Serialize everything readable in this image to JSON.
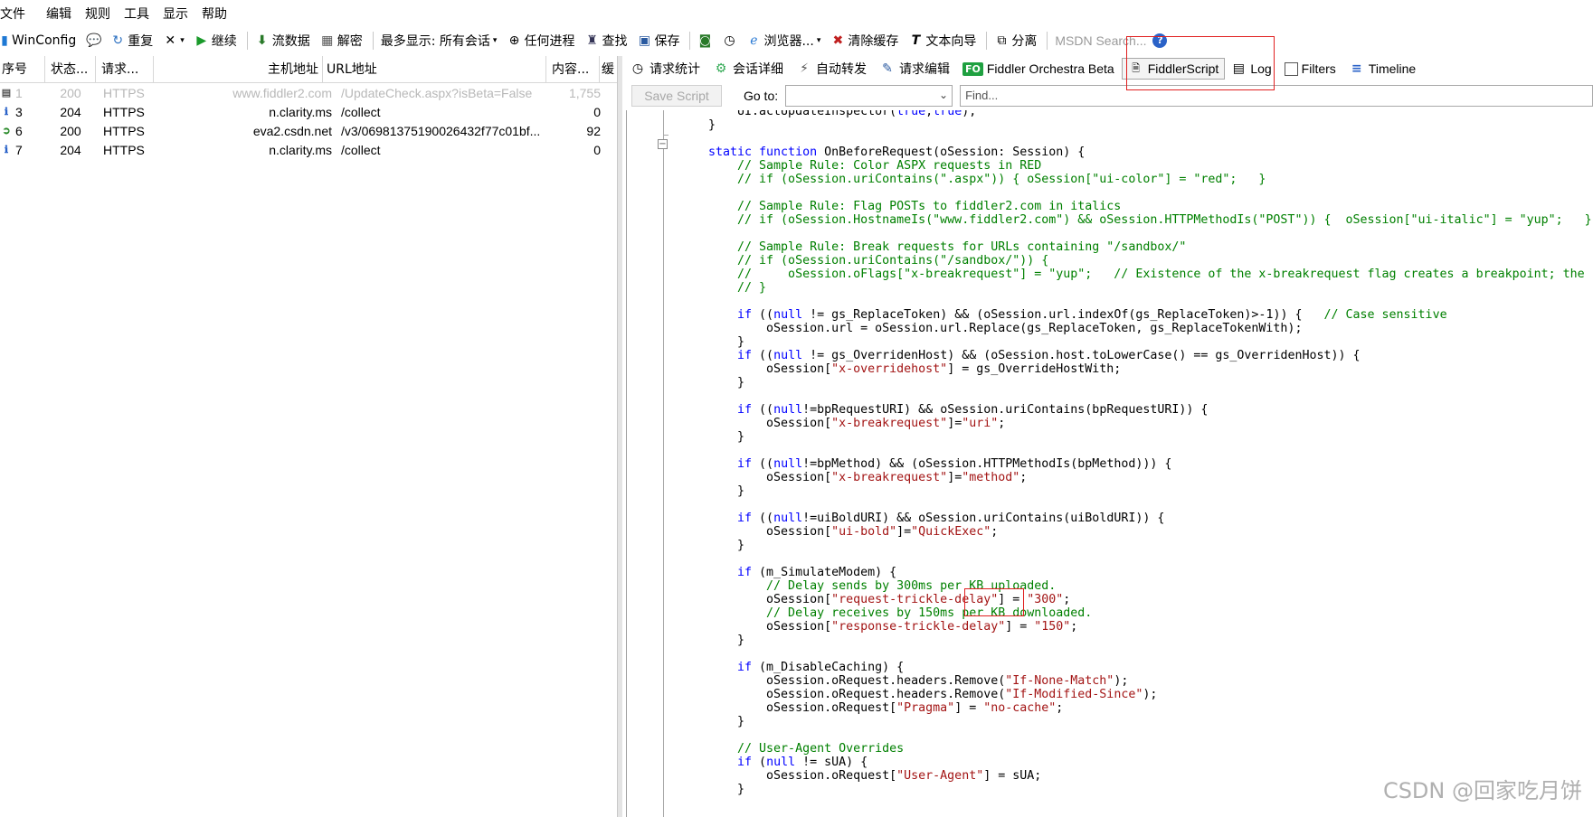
{
  "menu": [
    "文件",
    "编辑",
    "规则",
    "工具",
    "显示",
    "帮助"
  ],
  "toolbar": {
    "winconfig": "WinConfig",
    "replay": "重复",
    "continue": "继续",
    "stream": "流数据",
    "decode": "解密",
    "keep_label": "最多显示: 所有会话",
    "any_process": "任何进程",
    "find": "查找",
    "save": "保存",
    "browser": "浏览器...",
    "clear_cache": "清除缓存",
    "text_wizard": "文本向导",
    "tearoff": "分离",
    "msdn_search": "MSDN Search..."
  },
  "sessions": {
    "headers": [
      "序号",
      "状态...",
      "请求...",
      "主机地址",
      "URL地址",
      "内容...",
      "缓"
    ],
    "rows": [
      {
        "icon": "doc-icon",
        "num": "1",
        "status": "200",
        "proto": "HTTPS",
        "host": "www.fiddler2.com",
        "url": "/UpdateCheck.aspx?isBeta=False",
        "body": "1,755",
        "dim": true
      },
      {
        "icon": "info-icon",
        "num": "3",
        "status": "204",
        "proto": "HTTPS",
        "host": "n.clarity.ms",
        "url": "/collect",
        "body": "0",
        "dim": false
      },
      {
        "icon": "script-icon",
        "num": "6",
        "status": "200",
        "proto": "HTTPS",
        "host": "eva2.csdn.net",
        "url": "/v3/06981375190026432f77c01bf...",
        "body": "92",
        "dim": false
      },
      {
        "icon": "info-icon",
        "num": "7",
        "status": "204",
        "proto": "HTTPS",
        "host": "n.clarity.ms",
        "url": "/collect",
        "body": "0",
        "dim": false
      }
    ]
  },
  "tabs": {
    "statistics": "请求统计",
    "inspectors": "会话详细",
    "autoresponder": "自动转发",
    "composer": "请求编辑",
    "orchestra_badge": "FO",
    "orchestra": "Fiddler Orchestra Beta",
    "fiddlerscript": "FiddlerScript",
    "log": "Log",
    "filters": "Filters",
    "timeline": "Timeline"
  },
  "scriptbar": {
    "save_script": "Save Script",
    "goto": "Go to:",
    "find_placeholder": "Find..."
  },
  "code_lines": [
    [
      [
        "",
        "    UI.actUpdateInspector("
      ],
      [
        "k",
        "true"
      ],
      [
        "",
        ","
      ],
      [
        "k",
        "true"
      ],
      [
        "",
        ");"
      ]
    ],
    [
      [
        "",
        "}"
      ]
    ],
    [
      [
        "",
        ""
      ]
    ],
    [
      [
        "k",
        "static function "
      ],
      [
        "",
        "OnBeforeRequest(oSession: Session) {"
      ]
    ],
    [
      [
        "cm",
        "    // Sample Rule: Color ASPX requests in RED"
      ]
    ],
    [
      [
        "cm",
        "    // if (oSession.uriContains(\".aspx\")) { oSession[\"ui-color\"] = \"red\";   }"
      ]
    ],
    [
      [
        "",
        ""
      ]
    ],
    [
      [
        "cm",
        "    // Sample Rule: Flag POSTs to fiddler2.com in italics"
      ]
    ],
    [
      [
        "cm",
        "    // if (oSession.HostnameIs(\"www.fiddler2.com\") && oSession.HTTPMethodIs(\"POST\")) {  oSession[\"ui-italic\"] = \"yup\";   }"
      ]
    ],
    [
      [
        "",
        ""
      ]
    ],
    [
      [
        "cm",
        "    // Sample Rule: Break requests for URLs containing \"/sandbox/\""
      ]
    ],
    [
      [
        "cm",
        "    // if (oSession.uriContains(\"/sandbox/\")) {"
      ]
    ],
    [
      [
        "cm",
        "    //     oSession.oFlags[\"x-breakrequest\"] = \"yup\";   // Existence of the x-breakrequest flag creates a breakpoint; the \"yup\" value is unimportant."
      ]
    ],
    [
      [
        "cm",
        "    // }"
      ]
    ],
    [
      [
        "",
        ""
      ]
    ],
    [
      [
        "k",
        "    if "
      ],
      [
        "",
        "(("
      ],
      [
        "k",
        "null"
      ],
      [
        "",
        " != gs_ReplaceToken) && (oSession.url.indexOf(gs_ReplaceToken)>-1)) {   "
      ],
      [
        "cm",
        "// Case sensitive"
      ]
    ],
    [
      [
        "",
        "        oSession.url = oSession.url.Replace(gs_ReplaceToken, gs_ReplaceTokenWith);"
      ]
    ],
    [
      [
        "",
        "    }"
      ]
    ],
    [
      [
        "k",
        "    if "
      ],
      [
        "",
        "(("
      ],
      [
        "k",
        "null"
      ],
      [
        "",
        " != gs_OverridenHost) && (oSession.host.toLowerCase() == gs_OverridenHost)) {"
      ]
    ],
    [
      [
        "",
        "        oSession["
      ],
      [
        "s",
        "\"x-overridehost\""
      ],
      [
        "",
        "] = gs_OverrideHostWith;"
      ]
    ],
    [
      [
        "",
        "    }"
      ]
    ],
    [
      [
        "",
        ""
      ]
    ],
    [
      [
        "k",
        "    if "
      ],
      [
        "",
        "(("
      ],
      [
        "k",
        "null"
      ],
      [
        "",
        "!=bpRequestURI) && oSession.uriContains(bpRequestURI)) {"
      ]
    ],
    [
      [
        "",
        "        oSession["
      ],
      [
        "s",
        "\"x-breakrequest\""
      ],
      [
        "",
        "]="
      ],
      [
        "s",
        "\"uri\""
      ],
      [
        "",
        ";"
      ]
    ],
    [
      [
        "",
        "    }"
      ]
    ],
    [
      [
        "",
        ""
      ]
    ],
    [
      [
        "k",
        "    if "
      ],
      [
        "",
        "(("
      ],
      [
        "k",
        "null"
      ],
      [
        "",
        "!=bpMethod) && (oSession.HTTPMethodIs(bpMethod))) {"
      ]
    ],
    [
      [
        "",
        "        oSession["
      ],
      [
        "s",
        "\"x-breakrequest\""
      ],
      [
        "",
        "]="
      ],
      [
        "s",
        "\"method\""
      ],
      [
        "",
        ";"
      ]
    ],
    [
      [
        "",
        "    }"
      ]
    ],
    [
      [
        "",
        ""
      ]
    ],
    [
      [
        "k",
        "    if "
      ],
      [
        "",
        "(("
      ],
      [
        "k",
        "null"
      ],
      [
        "",
        "!=uiBoldURI) && oSession.uriContains(uiBoldURI)) {"
      ]
    ],
    [
      [
        "",
        "        oSession["
      ],
      [
        "s",
        "\"ui-bold\""
      ],
      [
        "",
        "]="
      ],
      [
        "s",
        "\"QuickExec\""
      ],
      [
        "",
        ";"
      ]
    ],
    [
      [
        "",
        "    }"
      ]
    ],
    [
      [
        "",
        ""
      ]
    ],
    [
      [
        "k",
        "    if "
      ],
      [
        "",
        "(m_SimulateModem) {"
      ]
    ],
    [
      [
        "cm",
        "        // Delay sends by 300ms per KB uploaded."
      ]
    ],
    [
      [
        "",
        "        oSession["
      ],
      [
        "s",
        "\"request-trickle-delay\""
      ],
      [
        "",
        "] = "
      ],
      [
        "s",
        "\"300\""
      ],
      [
        "",
        ";"
      ]
    ],
    [
      [
        "cm",
        "        // Delay receives by 150ms per KB downloaded."
      ]
    ],
    [
      [
        "",
        "        oSession["
      ],
      [
        "s",
        "\"response-trickle-delay\""
      ],
      [
        "",
        "] = "
      ],
      [
        "s",
        "\"150\""
      ],
      [
        "",
        ";"
      ]
    ],
    [
      [
        "",
        "    }"
      ]
    ],
    [
      [
        "",
        ""
      ]
    ],
    [
      [
        "k",
        "    if "
      ],
      [
        "",
        "(m_DisableCaching) {"
      ]
    ],
    [
      [
        "",
        "        oSession.oRequest.headers.Remove("
      ],
      [
        "s",
        "\"If-None-Match\""
      ],
      [
        "",
        ");"
      ]
    ],
    [
      [
        "",
        "        oSession.oRequest.headers.Remove("
      ],
      [
        "s",
        "\"If-Modified-Since\""
      ],
      [
        "",
        ");"
      ]
    ],
    [
      [
        "",
        "        oSession.oRequest["
      ],
      [
        "s",
        "\"Pragma\""
      ],
      [
        "",
        "] = "
      ],
      [
        "s",
        "\"no-cache\""
      ],
      [
        "",
        ";"
      ]
    ],
    [
      [
        "",
        "    }"
      ]
    ],
    [
      [
        "",
        ""
      ]
    ],
    [
      [
        "cm",
        "    // User-Agent Overrides"
      ]
    ],
    [
      [
        "k",
        "    if "
      ],
      [
        "",
        "("
      ],
      [
        "k",
        "null"
      ],
      [
        "",
        " != sUA) {"
      ]
    ],
    [
      [
        "",
        "        oSession.oRequest["
      ],
      [
        "s",
        "\"User-Agent\""
      ],
      [
        "",
        "] = sUA;"
      ]
    ],
    [
      [
        "",
        "    }"
      ]
    ]
  ],
  "watermark": "CSDN @回家吃月饼",
  "colors": {
    "keyword": "#0000ff",
    "comment": "#008000",
    "string": "#a31515",
    "highlight": "#e02020"
  }
}
